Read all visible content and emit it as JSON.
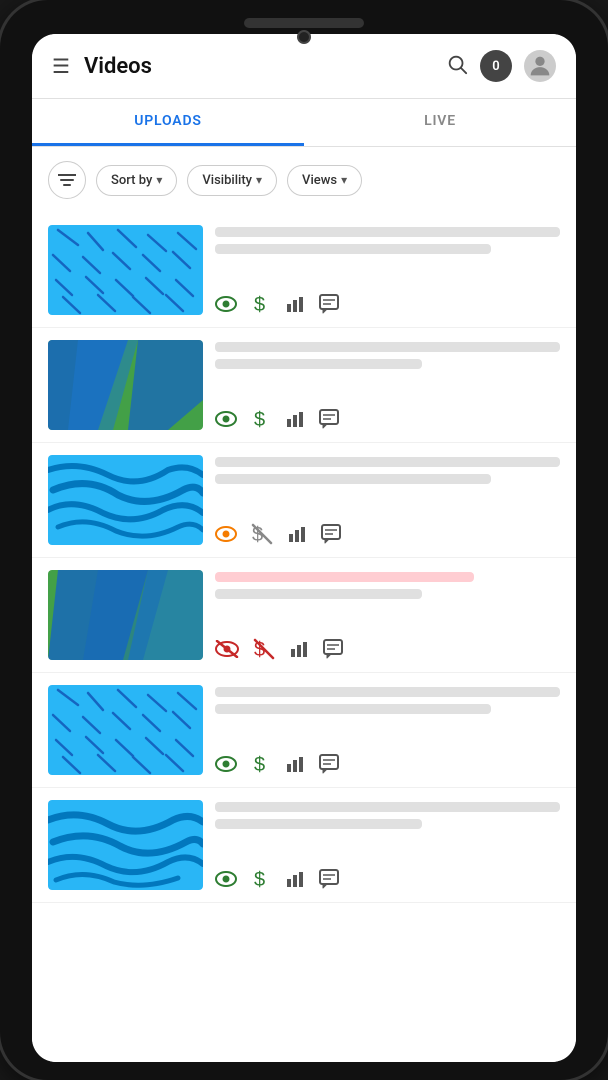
{
  "header": {
    "title": "Videos",
    "notification_count": "0",
    "menu_icon": "☰",
    "search_icon": "🔍"
  },
  "tabs": [
    {
      "id": "uploads",
      "label": "UPLOADS",
      "active": true
    },
    {
      "id": "live",
      "label": "LIVE",
      "active": false
    }
  ],
  "filters": {
    "filter_icon_label": "≡",
    "sort_by_label": "Sort by",
    "visibility_label": "Visibility",
    "views_label": "Views"
  },
  "videos": [
    {
      "id": 1,
      "thumb_type": "diagonal",
      "thumb_bg": "#29b6f6",
      "thumb_pattern": "#1565c0",
      "meta_lines": [
        "full",
        "medium"
      ],
      "actions": {
        "eye": "visible",
        "dollar": "enabled",
        "bar": true,
        "comment": true
      }
    },
    {
      "id": 2,
      "thumb_type": "abstract",
      "thumb_bg": "#43a047",
      "thumb_pattern": "#1565c0",
      "meta_lines": [
        "full",
        "short"
      ],
      "actions": {
        "eye": "visible",
        "dollar": "enabled",
        "bar": true,
        "comment": true
      }
    },
    {
      "id": 3,
      "thumb_type": "brush",
      "thumb_bg": "#29b6f6",
      "thumb_pattern": "#0277bd",
      "meta_lines": [
        "full",
        "medium"
      ],
      "actions": {
        "eye": "visible",
        "dollar": "disabled-orange",
        "bar": true,
        "comment": true
      }
    },
    {
      "id": 4,
      "thumb_type": "abstract",
      "thumb_bg": "#43a047",
      "thumb_pattern": "#1565c0",
      "meta_lines": [
        "error",
        "short"
      ],
      "actions": {
        "eye": "hidden",
        "dollar": "disabled-red",
        "bar": true,
        "comment": true
      }
    },
    {
      "id": 5,
      "thumb_type": "diagonal",
      "thumb_bg": "#29b6f6",
      "thumb_pattern": "#1565c0",
      "meta_lines": [
        "full",
        "medium"
      ],
      "actions": {
        "eye": "visible",
        "dollar": "enabled",
        "bar": true,
        "comment": true
      }
    },
    {
      "id": 6,
      "thumb_type": "brush2",
      "thumb_bg": "#29b6f6",
      "thumb_pattern": "#0277bd",
      "meta_lines": [
        "full",
        "short"
      ],
      "actions": {
        "eye": "visible",
        "dollar": "enabled",
        "bar": true,
        "comment": true
      }
    }
  ]
}
